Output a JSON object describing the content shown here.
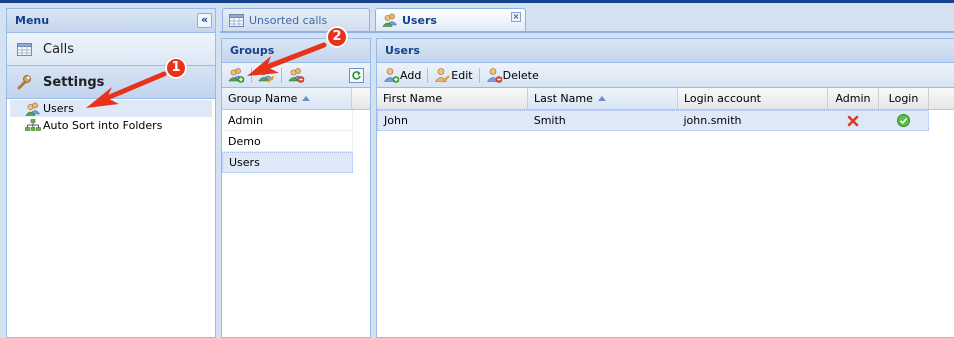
{
  "menu": {
    "title": "Menu",
    "collapse_glyph": "«",
    "sections": [
      {
        "label": "Calls",
        "icon": "calendar-grid-icon"
      },
      {
        "label": "Settings",
        "icon": "wrench-icon"
      }
    ],
    "tree_items": [
      {
        "label": "Users",
        "icon": "users-icon",
        "selected": true
      },
      {
        "label": "Auto Sort into Folders",
        "icon": "folder-tree-icon",
        "selected": false
      }
    ]
  },
  "tabs": [
    {
      "label": "Unsorted calls",
      "icon": "calendar-grid-icon",
      "active": false
    },
    {
      "label": "Users",
      "icon": "users-icon",
      "active": true
    }
  ],
  "tab_close_glyph": "×",
  "groups": {
    "title": "Groups",
    "toolbar_icons": [
      "add-group-icon",
      "edit-group-icon",
      "delete-group-icon",
      "refresh-icon"
    ],
    "column_header": "Group Name",
    "rows": [
      "Admin",
      "Demo",
      "Users"
    ],
    "selected_row": 2
  },
  "users": {
    "title": "Users",
    "toolbar": {
      "add": "Add",
      "edit": "Edit",
      "delete": "Delete"
    },
    "columns": [
      "First Name",
      "Last Name",
      "Login account",
      "Admin",
      "Login"
    ],
    "sorted_column": "Last Name",
    "rows": [
      {
        "first_name": "John",
        "last_name": "Smith",
        "login_account": "john.smith",
        "admin": false,
        "login": true
      }
    ]
  },
  "callouts": [
    "1",
    "2"
  ],
  "colors": {
    "header_text": "#15428b",
    "panel_border": "#99bbe8",
    "selection": "#dfe8f6",
    "callout_red": "#e8331a"
  }
}
